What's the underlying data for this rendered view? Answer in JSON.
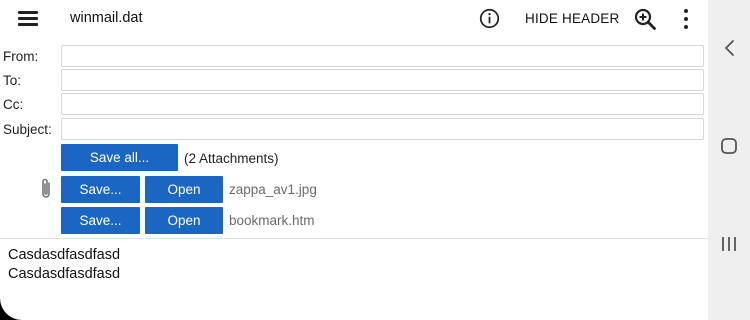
{
  "app": {
    "title": "winmail.dat",
    "hide_header_label": "HIDE HEADER"
  },
  "icons": {
    "menu": "hamburger-menu-icon",
    "info": "info-icon",
    "zoom": "zoom-in-icon",
    "more": "more-vert-icon",
    "attachment": "paperclip-icon"
  },
  "header": {
    "from_label": "From:",
    "to_label": "To:",
    "cc_label": "Cc:",
    "subject_label": "Subject:",
    "from_value": "",
    "to_value": "",
    "cc_value": "",
    "subject_value": ""
  },
  "attachments": {
    "save_all_label": "Save all...",
    "count_text": "(2 Attachments)",
    "items": [
      {
        "save_label": "Save...",
        "open_label": "Open",
        "file_name": "zappa_av1.jpg"
      },
      {
        "save_label": "Save...",
        "open_label": "Open",
        "file_name": "bookmark.htm"
      }
    ]
  },
  "body": {
    "lines": [
      "Casdasdfasdfasd",
      "Casdasdfasdfasd"
    ]
  },
  "colors": {
    "accent": "#1a66c2",
    "nav_bar": "#efefef",
    "file_name": "#6b6b6b"
  }
}
